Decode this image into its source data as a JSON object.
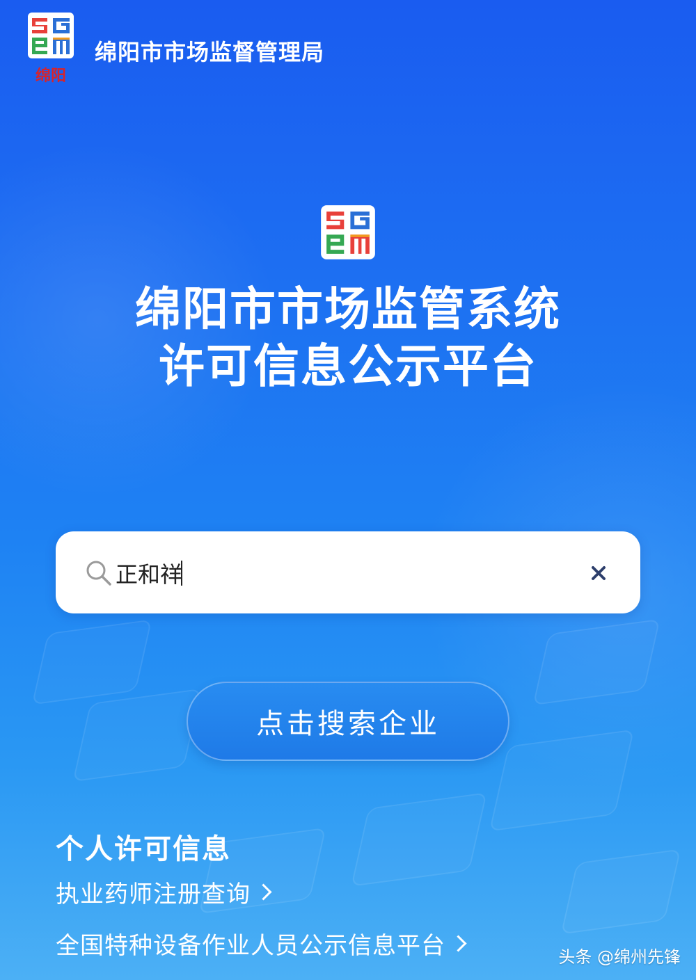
{
  "header": {
    "title": "绵阳市市场监督管理局",
    "logo_icon": "smr-logo-icon",
    "logo_caption": "绵阳"
  },
  "main": {
    "title_line1": "绵阳市市场监管系统",
    "title_line2": "许可信息公示平台",
    "logo_icon": "smr-logo-icon"
  },
  "search": {
    "value": "正和祥",
    "search_icon": "search-icon",
    "clear_icon": "close-icon",
    "button_label": "点击搜索企业"
  },
  "personal": {
    "section_title": "个人许可信息",
    "links": [
      {
        "label": "执业药师注册查询"
      },
      {
        "label": "全国特种设备作业人员公示信息平台"
      }
    ]
  },
  "watermark": "头条 @绵州先锋",
  "colors": {
    "background_top": "#1a5cf0",
    "background_bottom": "#4cb0f5",
    "accent_text": "#ffffff",
    "logo_red": "#e8403a",
    "logo_blue": "#2a6fd6",
    "logo_green": "#35a853",
    "logo_orange": "#f29a1f"
  }
}
